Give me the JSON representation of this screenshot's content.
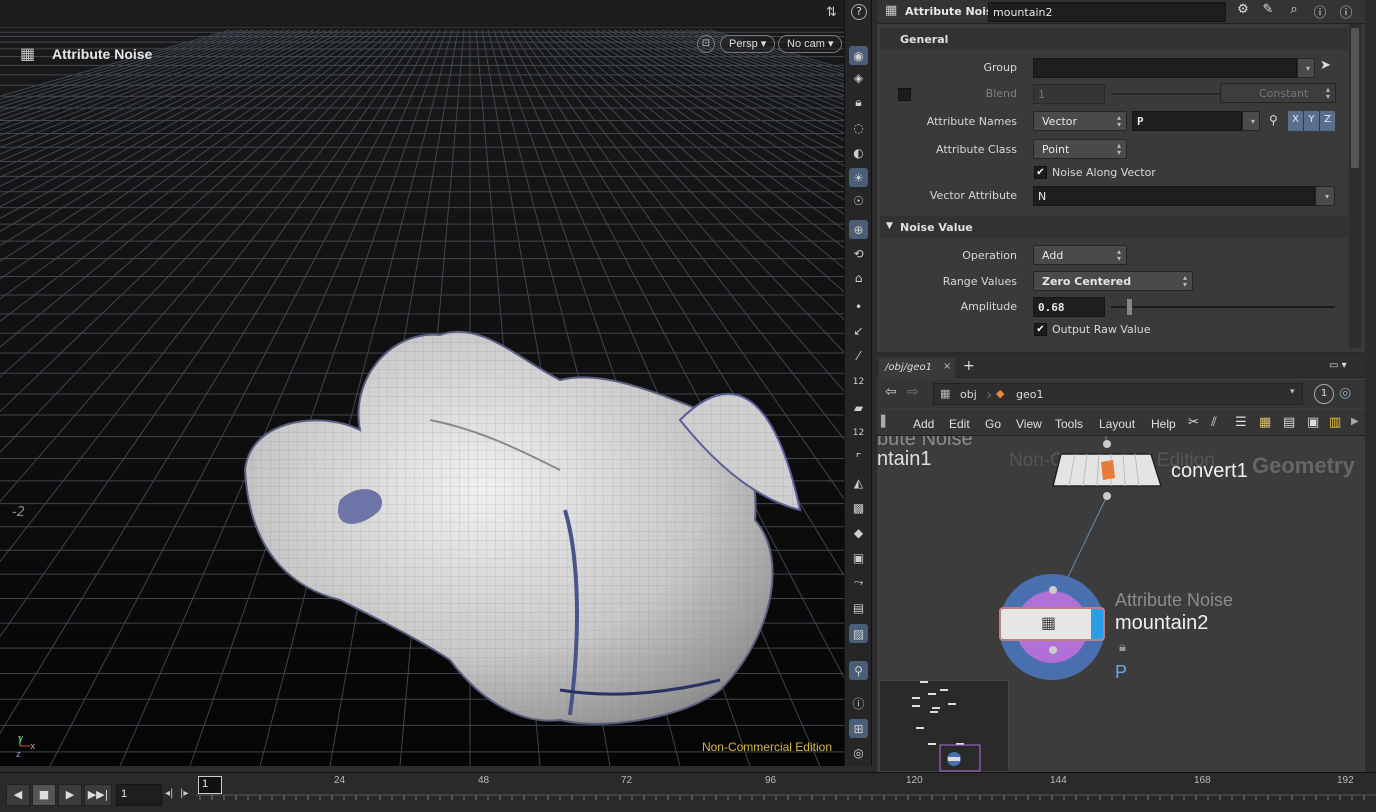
{
  "viewport": {
    "title": "Attribute Noise",
    "view_menu": "Persp",
    "cam_menu": "No cam",
    "watermark": "Non-Commercial Edition",
    "grid_label": "-2",
    "axis_y": "y",
    "axis_x": "x",
    "axis_z": "z"
  },
  "params": {
    "node_type": "Attribute Noise",
    "node_name": "mountain2",
    "sections": {
      "general": "General",
      "noise_value": "Noise Value"
    },
    "group": {
      "label": "Group",
      "value": ""
    },
    "blend": {
      "label": "Blend",
      "value": "1",
      "mode": "Constant"
    },
    "attribute_names": {
      "label": "Attribute Names",
      "type": "Vector",
      "value": "P",
      "x": "X",
      "y": "Y",
      "z": "Z"
    },
    "attribute_class": {
      "label": "Attribute Class",
      "value": "Point"
    },
    "noise_along_vector": {
      "label": "Noise Along Vector",
      "checked": true
    },
    "vector_attribute": {
      "label": "Vector Attribute",
      "value": "N"
    },
    "operation": {
      "label": "Operation",
      "value": "Add"
    },
    "range_values": {
      "label": "Range Values",
      "value": "Zero Centered"
    },
    "amplitude": {
      "label": "Amplitude",
      "value": "0.68",
      "fraction": 0.068
    },
    "output_raw_value": {
      "label": "Output Raw Value",
      "checked": true
    }
  },
  "network": {
    "tab_path": "/obj/geo1",
    "path_obj": "obj",
    "path_geo": "geo1",
    "path_badge": "1",
    "menus": [
      "Add",
      "Edit",
      "Go",
      "View",
      "Tools",
      "Layout",
      "Help"
    ],
    "watermark": "Non-Commercial Edition",
    "context": "Geometry",
    "prev_node_type": "bute Noise",
    "prev_node_name": "ntain1",
    "convert_node": "convert1",
    "noise_node_type": "Attribute Noise",
    "noise_node_name": "mountain2",
    "noise_node_attr": "P"
  },
  "timeline": {
    "current_frame": "1",
    "frame_marker": "1",
    "ticks": [
      "24",
      "48",
      "72",
      "96",
      "120",
      "144",
      "168",
      "192"
    ]
  },
  "colors": {
    "accent_blue": "#5a6f8c",
    "watermark": "#d4b84a",
    "node_selected": "#2a9fe6"
  }
}
